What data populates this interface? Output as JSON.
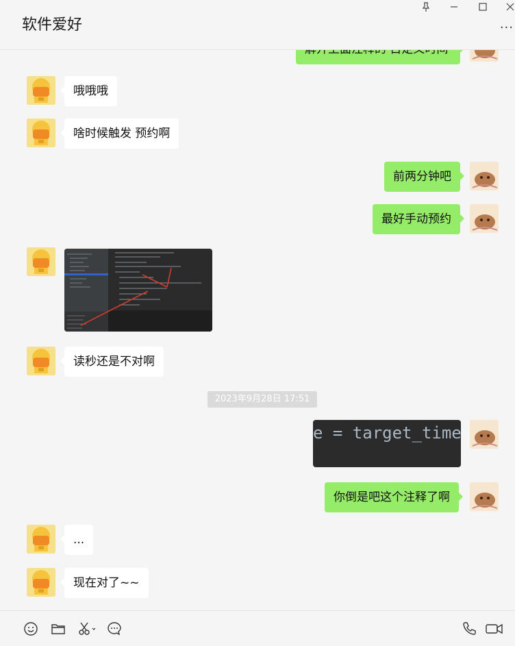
{
  "window": {
    "title": "软件爱好",
    "controls": {
      "pin": "pin-icon",
      "minimize": "minimize-icon",
      "maximize": "maximize-icon",
      "close": "close-icon"
    },
    "more_label": "···"
  },
  "messages": {
    "m0": {
      "side": "out",
      "text": "解开上面注释的 目定义时间"
    },
    "m1": {
      "side": "in",
      "text": "哦哦哦"
    },
    "m2": {
      "side": "in",
      "text": "啥时候触发 预约啊"
    },
    "m3": {
      "side": "out",
      "text": "前两分钟吧"
    },
    "m4": {
      "side": "out",
      "text": "最好手动预约"
    },
    "m5": {
      "side": "in",
      "type": "image",
      "description": "ide-screenshot"
    },
    "m6": {
      "side": "in",
      "text": "读秒还是不对啊"
    },
    "ts": {
      "text": "2023年9月28日 17:51"
    },
    "m7": {
      "side": "out",
      "type": "image",
      "code": "e = target_time"
    },
    "m8": {
      "side": "out",
      "text": "你倒是吧这个注释了啊"
    },
    "m9": {
      "side": "in",
      "text": "..."
    },
    "m10": {
      "side": "in",
      "text": "现在对了~~"
    }
  },
  "toolbar": {
    "left": [
      "emoji-icon",
      "folder-icon",
      "scissors-icon",
      "chat-history-icon"
    ],
    "right": [
      "phone-icon",
      "video-call-icon"
    ]
  },
  "colors": {
    "outgoing_bubble": "#95ec69",
    "incoming_bubble": "#ffffff",
    "background": "#f5f5f5",
    "timestamp_bg": "#dadada"
  }
}
